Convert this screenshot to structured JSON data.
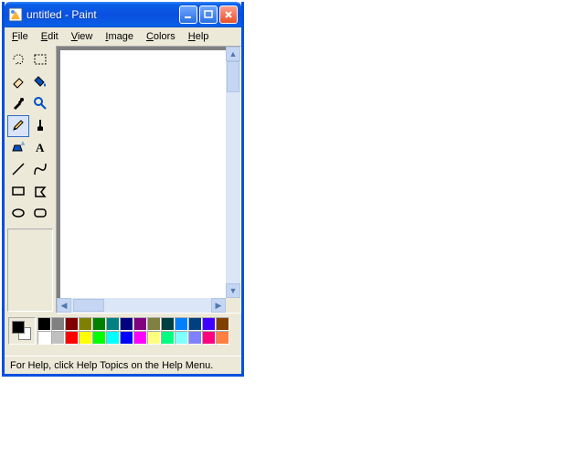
{
  "window": {
    "title": "untitled - Paint"
  },
  "menu": {
    "file": "File",
    "edit": "Edit",
    "view": "View",
    "image": "Image",
    "colors": "Colors",
    "help": "Help"
  },
  "tools": [
    {
      "name": "free-select",
      "selected": false
    },
    {
      "name": "rect-select",
      "selected": false
    },
    {
      "name": "eraser",
      "selected": false
    },
    {
      "name": "fill",
      "selected": false
    },
    {
      "name": "picker",
      "selected": false
    },
    {
      "name": "magnifier",
      "selected": false
    },
    {
      "name": "pencil",
      "selected": true
    },
    {
      "name": "brush",
      "selected": false
    },
    {
      "name": "airbrush",
      "selected": false
    },
    {
      "name": "text",
      "selected": false
    },
    {
      "name": "line",
      "selected": false
    },
    {
      "name": "curve",
      "selected": false
    },
    {
      "name": "rectangle",
      "selected": false
    },
    {
      "name": "polygon",
      "selected": false
    },
    {
      "name": "ellipse",
      "selected": false
    },
    {
      "name": "rounded-rect",
      "selected": false
    }
  ],
  "current_colors": {
    "fg": "#000000",
    "bg": "#ffffff"
  },
  "palette": [
    "#000000",
    "#808080",
    "#800000",
    "#808000",
    "#008000",
    "#008080",
    "#000080",
    "#800080",
    "#808040",
    "#004040",
    "#0080ff",
    "#004080",
    "#4000ff",
    "#804000",
    "#ffffff",
    "#c0c0c0",
    "#ff0000",
    "#ffff00",
    "#00ff00",
    "#00ffff",
    "#0000ff",
    "#ff00ff",
    "#ffff80",
    "#00ff80",
    "#80ffff",
    "#8080ff",
    "#ff0080",
    "#ff8040"
  ],
  "status": {
    "text": "For Help, click Help Topics on the Help Menu."
  }
}
